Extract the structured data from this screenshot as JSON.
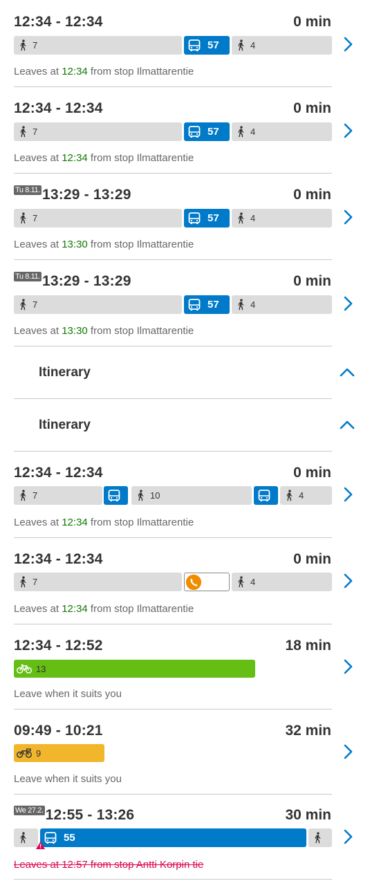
{
  "itineraries": [
    {
      "times": "12:34 - 12:34",
      "duration": "0 min",
      "legs": {
        "walk1": "7",
        "bus": "57",
        "walk2": "4"
      },
      "info": {
        "prefix": "Leaves at ",
        "time": "12:34",
        "suffix": " from stop Ilmattarentie"
      }
    },
    {
      "times": "12:34 - 12:34",
      "duration": "0 min",
      "legs": {
        "walk1": "7",
        "bus": "57",
        "walk2": "4"
      },
      "info": {
        "prefix": "Leaves at ",
        "time": "12:34",
        "suffix": " from stop Ilmattarentie"
      }
    },
    {
      "date": "Tu 8.11.",
      "times": "13:29 - 13:29",
      "duration": "0 min",
      "legs": {
        "walk1": "7",
        "bus": "57",
        "walk2": "4"
      },
      "info": {
        "prefix": "Leaves at ",
        "time": "13:30",
        "suffix": " from stop Ilmattarentie"
      }
    },
    {
      "date": "Tu 8.11.",
      "times": "13:29 - 13:29",
      "duration": "0 min",
      "legs": {
        "walk1": "7",
        "bus": "57",
        "walk2": "4"
      },
      "info": {
        "prefix": "Leaves at ",
        "time": "13:30",
        "suffix": " from stop Ilmattarentie"
      }
    },
    {
      "times": "12:34 - 12:34",
      "duration": "0 min",
      "legs": {
        "walk1": "7",
        "walk2": "10",
        "walk3": "4"
      },
      "info": {
        "prefix": "Leaves at ",
        "time": "12:34",
        "suffix": " from stop Ilmattarentie"
      }
    },
    {
      "times": "12:34 - 12:34",
      "duration": "0 min",
      "legs": {
        "walk1": "7",
        "walk2": "4"
      },
      "info": {
        "prefix": "Leaves at ",
        "time": "12:34",
        "suffix": " from stop Ilmattarentie"
      }
    },
    {
      "times": "12:34 - 12:52",
      "duration": "18 min",
      "legs": {
        "bike": "13"
      },
      "info": {
        "text": "Leave when it suits you"
      }
    },
    {
      "times": "09:49 - 10:21",
      "duration": "32 min",
      "legs": {
        "citybike": "9"
      },
      "info": {
        "text": "Leave when it suits you"
      }
    },
    {
      "date": "We 27.2.",
      "times": "12:55 - 13:26",
      "duration": "30 min",
      "legs": {
        "bus": "55"
      },
      "info": {
        "text": "Leaves at 12:57 from stop Antti Korpin tie"
      }
    }
  ],
  "sections": [
    {
      "title": "Itinerary"
    },
    {
      "title": "Itinerary"
    }
  ],
  "colors": {
    "bus": "#007ac9",
    "bike": "#64be14",
    "citybike": "#f2b62d",
    "walk": "#dcdcdc",
    "call": "#f08c00",
    "leave_time": "#0f7a00",
    "cancelled": "#dc0451",
    "chevron": "#007ac9"
  },
  "icons": {
    "walk": "walk-icon",
    "bus": "bus-icon",
    "bike": "bicycle-icon",
    "citybike": "citybike-icon",
    "call": "phone-icon",
    "next": "chevron-right-icon",
    "collapse": "chevron-up-icon",
    "alert": "alert-icon"
  }
}
